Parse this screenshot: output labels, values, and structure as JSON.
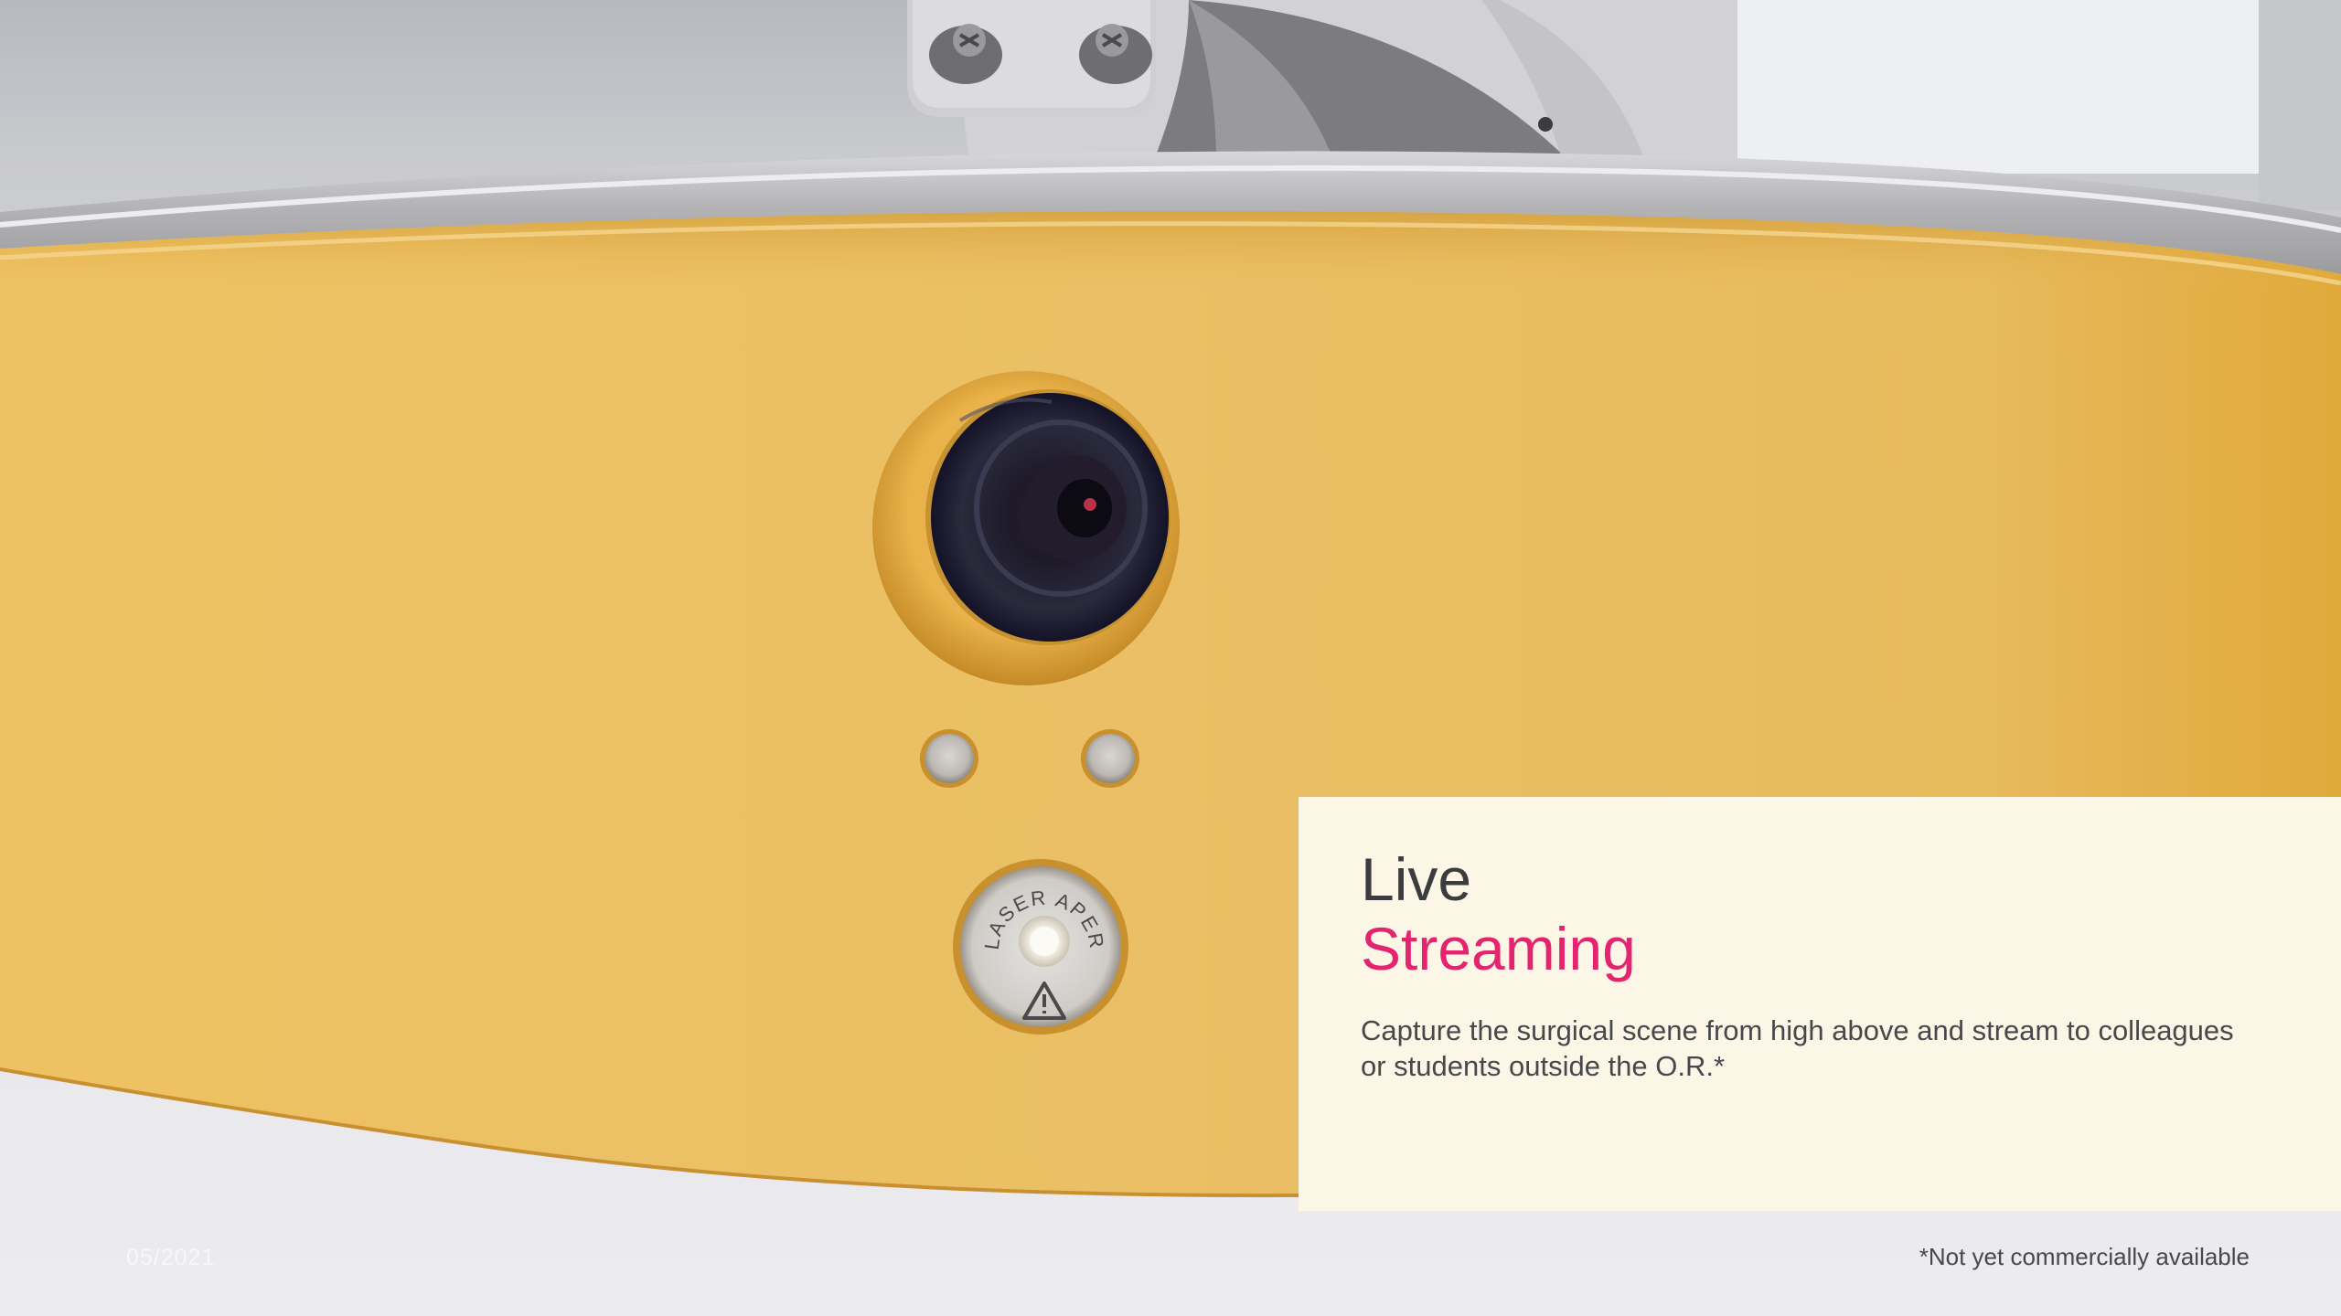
{
  "slide": {
    "title_line_1": "Live",
    "title_line_2": "Streaming",
    "description": "Capture the surgical scene from high above and stream to colleagues or students outside the O.R.*",
    "date": "05/2021",
    "footnote": "*Not yet commercially available"
  },
  "photo": {
    "aperture_label": "LASER APERTURE",
    "warning_icon": "warning-triangle-icon"
  },
  "colors": {
    "accent": "#e4246e",
    "heading": "#3c3c3f",
    "body_text": "#48484c",
    "panel_bg": "#fcf6e4",
    "housing_yellow": "#e9bd5e",
    "rim_silver": "#b9b9bb",
    "background": "#e9e9ec"
  }
}
